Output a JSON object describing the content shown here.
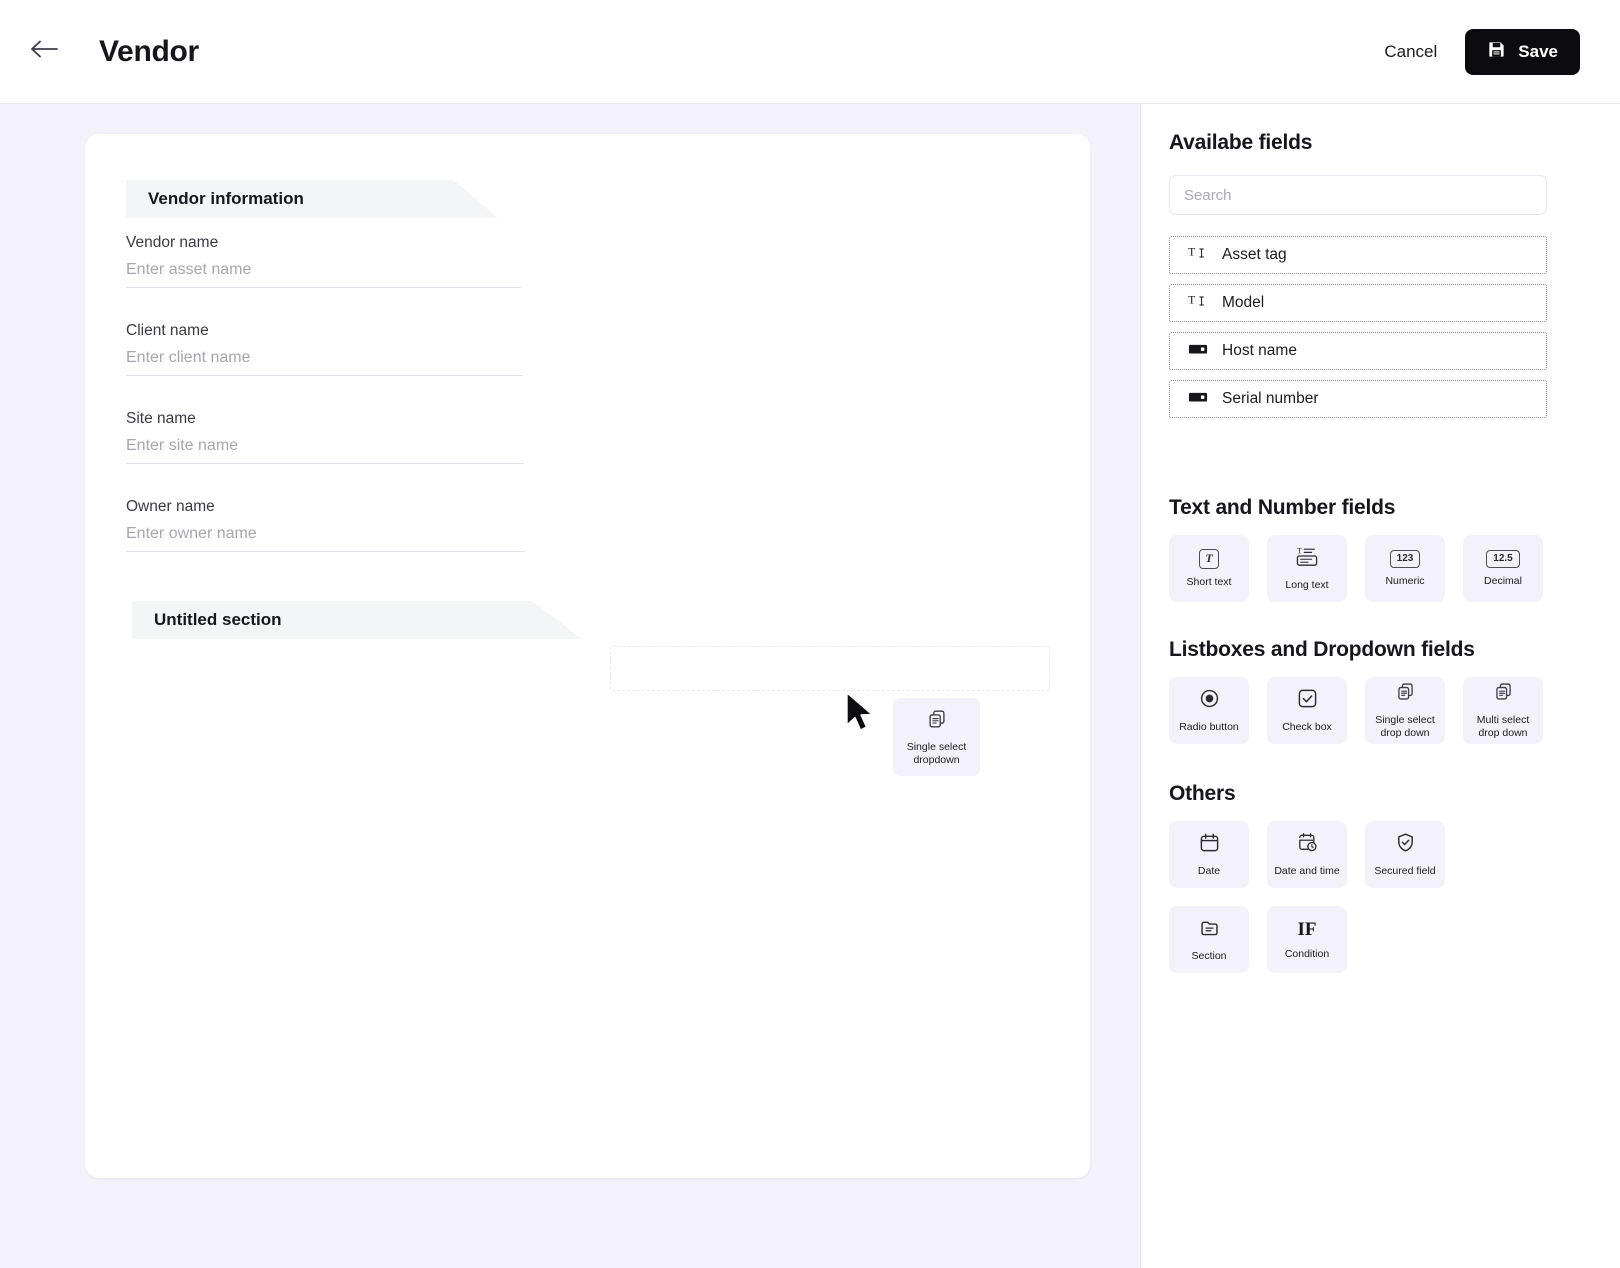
{
  "header": {
    "back_icon": "arrow-left-icon",
    "title": "Vendor",
    "cancel_label": "Cancel",
    "save_label": "Save",
    "save_icon": "save-floppy-icon",
    "save_bg": "#0c0c10"
  },
  "canvas": {
    "background": "#f4f3fb",
    "card_background": "#ffffff",
    "sections": [
      {
        "title": "Vendor information"
      },
      {
        "title": "Untitled section"
      }
    ],
    "fields": [
      {
        "label": "Vendor name",
        "value": "",
        "placeholder": "Enter asset name"
      },
      {
        "label": "Client name",
        "value": "",
        "placeholder": "Enter client name"
      },
      {
        "label": "Site name",
        "value": "",
        "placeholder": "Enter site name"
      },
      {
        "label": "Owner name",
        "value": "",
        "placeholder": "Enter owner name"
      }
    ],
    "drag_preview": {
      "label": "Single select dropdown",
      "icon": "single-select-dropdown-icon",
      "background": "#f3f2fb"
    },
    "drop_zone_visible": true
  },
  "sidebar": {
    "available_fields": {
      "title": "Availabe fields",
      "search": {
        "value": "",
        "placeholder": "Search",
        "icon": "search-input"
      },
      "items": [
        {
          "label": "Asset tag",
          "icon": "text-cursor-icon"
        },
        {
          "label": "Model",
          "icon": "text-cursor-icon"
        },
        {
          "label": "Host name",
          "icon": "input-box-icon"
        },
        {
          "label": "Serial number",
          "icon": "input-box-icon"
        }
      ]
    },
    "groups": [
      {
        "title": "Text and Number fields",
        "tiles": [
          {
            "label": "Short text",
            "icon": "boxed-t-icon",
            "glyph": "T"
          },
          {
            "label": "Long text",
            "icon": "long-text-icon",
            "glyph": ""
          },
          {
            "label": "Numeric",
            "icon": "boxed-123-icon",
            "glyph": "123"
          },
          {
            "label": "Decimal",
            "icon": "boxed-decimal-icon",
            "glyph": "12.5"
          }
        ]
      },
      {
        "title": "Listboxes and Dropdown fields",
        "tiles": [
          {
            "label": "Radio button",
            "icon": "radio-button-icon",
            "glyph": ""
          },
          {
            "label": "Check box",
            "icon": "checkbox-icon",
            "glyph": ""
          },
          {
            "label": "Single select drop down",
            "icon": "single-select-dropdown-icon",
            "glyph": ""
          },
          {
            "label": "Multi select drop down",
            "icon": "multi-select-dropdown-icon",
            "glyph": ""
          }
        ]
      },
      {
        "title": "Others",
        "tiles": [
          {
            "label": "Date",
            "icon": "calendar-icon",
            "glyph": ""
          },
          {
            "label": "Date and time",
            "icon": "calendar-clock-icon",
            "glyph": ""
          },
          {
            "label": "Secured field",
            "icon": "shield-check-icon",
            "glyph": ""
          },
          {
            "label": "Section",
            "icon": "section-folder-icon",
            "glyph": ""
          },
          {
            "label": "Condition",
            "icon": "if-condition-icon",
            "glyph": "IF"
          }
        ]
      }
    ]
  }
}
